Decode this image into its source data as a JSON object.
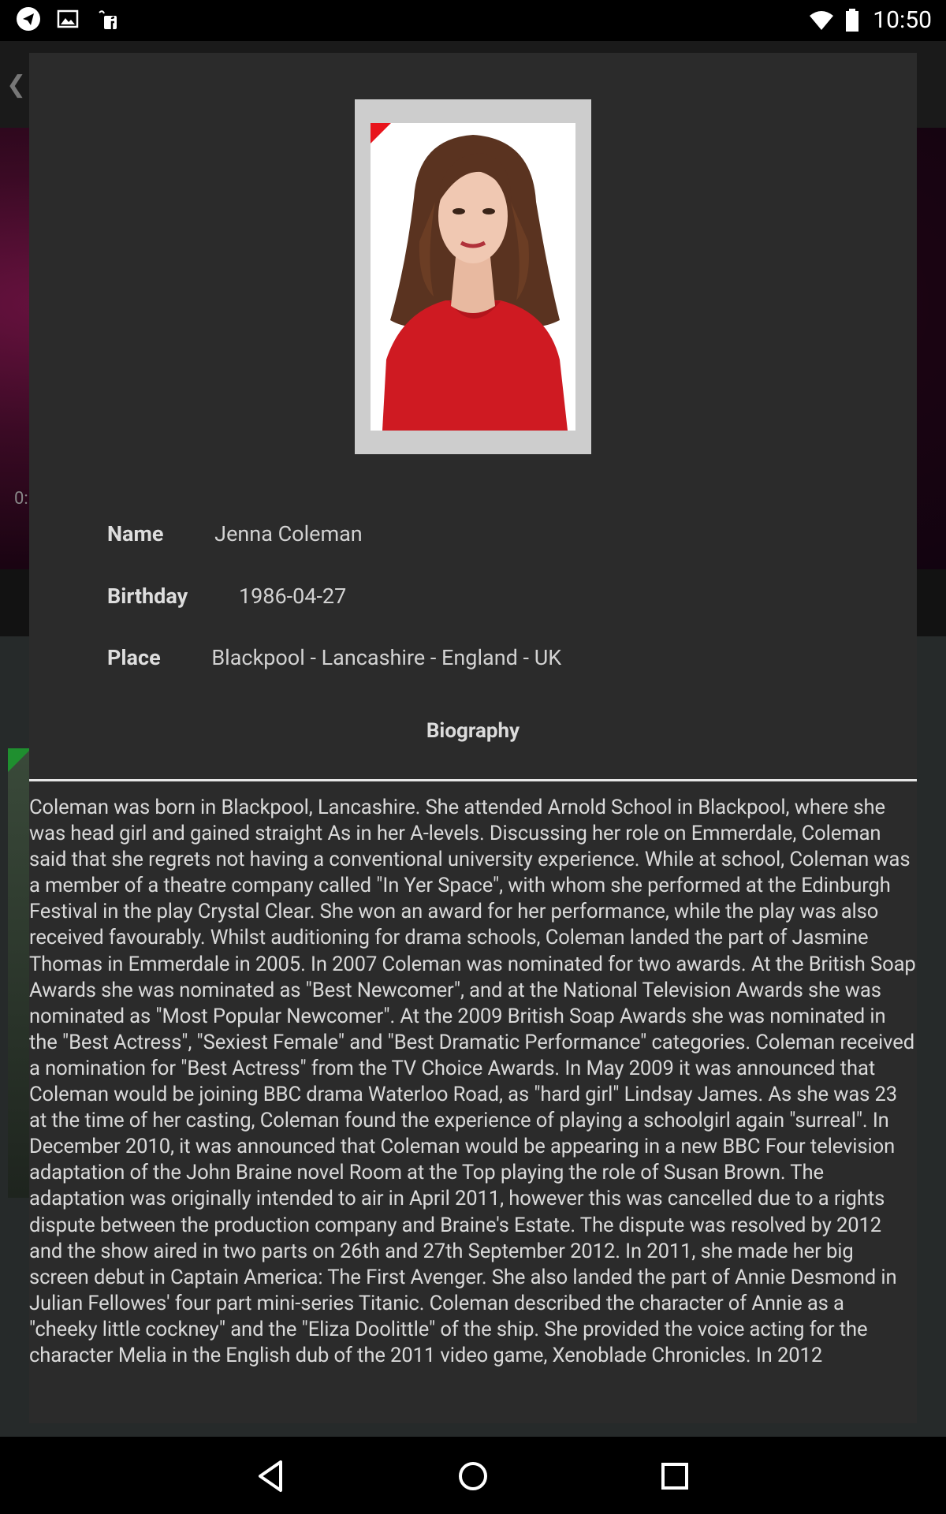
{
  "status_bar": {
    "time": "10:50",
    "left_icons": [
      "telegram-icon",
      "image-icon",
      "facebook-icon"
    ],
    "right_icons": [
      "wifi-icon",
      "battery-icon"
    ]
  },
  "background": {
    "back_glyph": "❮",
    "hero_time": "0:"
  },
  "actor": {
    "name_label": "Name",
    "name": "Jenna Coleman",
    "birthday_label": "Birthday",
    "birthday": "1986-04-27",
    "place_label": "Place",
    "place": "Blackpool - Lancashire - England - UK",
    "biography_heading": "Biography",
    "biography": "Coleman was born in Blackpool, Lancashire. She attended Arnold School in Blackpool, where she was head girl and gained straight As in her A-levels. Discussing her role on Emmerdale, Coleman said that she regrets not having a conventional university experience. While at school, Coleman was a member of a theatre company called \"In Yer Space\", with whom she performed at the Edinburgh Festival in the play Crystal Clear. She won an award for her performance, while the play was also received favourably. Whilst auditioning for drama schools, Coleman landed the part of Jasmine Thomas in Emmerdale in 2005. In 2007 Coleman was nominated for two awards. At the British Soap Awards she was nominated as \"Best Newcomer\", and at the National Television Awards she was nominated as \"Most Popular Newcomer\". At the 2009 British Soap Awards she was nominated in the \"Best Actress\", \"Sexiest Female\" and \"Best Dramatic Performance\" categories. Coleman received a nomination for \"Best Actress\" from the TV Choice Awards. In May 2009 it was announced that Coleman would be joining BBC drama Waterloo Road, as \"hard girl\" Lindsay James. As she was 23 at the time of her casting, Coleman found the experience of playing a schoolgirl again \"surreal\". In December 2010, it was announced that Coleman would be appearing in a new BBC Four television adaptation of the John Braine novel Room at the Top playing the role of Susan Brown. The adaptation was originally intended to air in April 2011, however this was cancelled due to a rights dispute between the production company and Braine's Estate. The dispute was resolved by 2012 and the show aired in two parts on 26th and 27th September 2012. In 2011, she made her big screen debut in Captain America: The First Avenger. She also landed the part of Annie Desmond in Julian Fellowes' four part mini-series Titanic. Coleman described the character of Annie as a \"cheeky little cockney\" and the \"Eliza Doolittle\" of the ship. She provided the voice acting for the character Melia in the English dub of the 2011 video game, Xenoblade Chronicles. In 2012"
  },
  "nav_bar": {
    "buttons": [
      "back-icon",
      "home-icon",
      "recents-icon"
    ]
  }
}
